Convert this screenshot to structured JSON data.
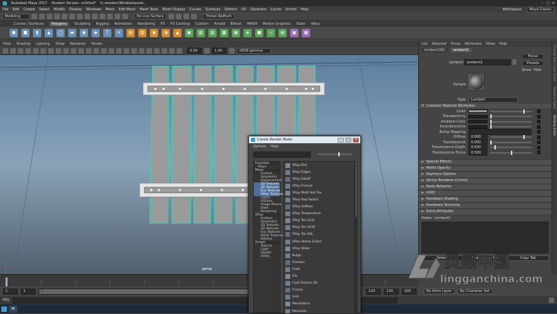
{
  "window": {
    "title_app": "Autodesk Maya 2017",
    "title_version": "Student Version: untitled*",
    "title_path": "\\\\\\ wooden\\Window\\wood..."
  },
  "menubar": {
    "items": [
      "File",
      "Edit",
      "Create",
      "Select",
      "Modify",
      "Display",
      "Windows",
      "Mesh",
      "Edit Mesh",
      "Mesh Tools",
      "Mesh Display",
      "Curves",
      "Surfaces",
      "Deform",
      "UV",
      "Generate",
      "Cache",
      "Arnold",
      "Help"
    ],
    "workspace_label": "Workspace:",
    "workspace_value": "Maya Classic"
  },
  "statusline": {
    "mode": "Modeling",
    "live_surface": "No Live Surface",
    "user": "Tristan Reifisch"
  },
  "shelf_tabs": [
    "Curves / Surfaces",
    "Polygons",
    "Sculpting",
    "Rigging",
    "Animation",
    "Rendering",
    "FX",
    "FX Caching",
    "Custom",
    "Arnold",
    "Bifrost",
    "MASH",
    "Motion Graphics",
    "XGen",
    "VRay"
  ],
  "viewport": {
    "menu": [
      "View",
      "Shading",
      "Lighting",
      "Show",
      "Renderer",
      "Panels"
    ],
    "field_a": "0.00",
    "field_b": "1.00",
    "color_space": "sRGB gamma",
    "camera_label": "persp"
  },
  "timeline": {
    "range_start": "1",
    "range_current": "1",
    "range_field": "1",
    "range_end_a": "120",
    "range_end_b": "120",
    "range_end_c": "200",
    "anim_layer": "No Anim Layer",
    "char_set": "No Character Set",
    "frame_right": "1"
  },
  "cmdline": {
    "label": "MEL"
  },
  "taskbar": {
    "item": "M"
  },
  "attribute_editor": {
    "menu": [
      "List",
      "Selected",
      "Focus",
      "Attributes",
      "Show",
      "Help"
    ],
    "tabs": [
      "lambert2SG",
      "lambert2"
    ],
    "node_label": "lambert:",
    "node_value": "lambert2",
    "focus_button": "Focus",
    "presets_button": "Presets",
    "show_button": "Show",
    "hide_button": "Hide",
    "sample_label": "Sample",
    "type_label": "Type",
    "type_value": "Lambert",
    "section_common": "Common Material Attributes",
    "attrs": [
      {
        "label": "Color",
        "value": ""
      },
      {
        "label": "Transparency",
        "value": ""
      },
      {
        "label": "Ambient Color",
        "value": ""
      },
      {
        "label": "Incandescence",
        "value": ""
      },
      {
        "label": "Bump Mapping",
        "value": ""
      },
      {
        "label": "Diffuse",
        "value": "0.800"
      },
      {
        "label": "Translucence",
        "value": "0.000"
      },
      {
        "label": "Translucence Depth",
        "value": "0.500"
      },
      {
        "label": "Translucence Focus",
        "value": "0.500"
      }
    ],
    "sections": [
      "Special Effects",
      "Matte Opacity",
      "Raytrace Options",
      "Vector Renderer Control",
      "Node Behavior",
      "UUID",
      "Hardware Shading",
      "Hardware Texturing",
      "Extra Attributes"
    ],
    "notes_label": "Notes:",
    "notes_value": "lambert2",
    "bottom_buttons": [
      "Select",
      "Load Attributes",
      "Copy Tab"
    ]
  },
  "right_strip": [
    "Channel Box / Layer Editor",
    "Modeling Toolkit",
    "Attribute Editor"
  ],
  "create_render_node": {
    "title": "Create Render Node",
    "menu": [
      "Options",
      "Help"
    ],
    "tree": [
      {
        "label": "Favorites",
        "kind": "head"
      },
      {
        "label": "Maya",
        "kind": "head2"
      },
      {
        "label": "Maya",
        "kind": "head"
      },
      {
        "label": "Surface",
        "kind": "item"
      },
      {
        "label": "Volumetric",
        "kind": "item"
      },
      {
        "label": "Displacement",
        "kind": "item"
      },
      {
        "label": "2D Textures",
        "kind": "hl"
      },
      {
        "label": "3D Textures",
        "kind": "hl"
      },
      {
        "label": "Env Textures",
        "kind": "hl"
      },
      {
        "label": "Other Textures",
        "kind": "hl"
      },
      {
        "label": "Lights",
        "kind": "item"
      },
      {
        "label": "Utilities",
        "kind": "item"
      },
      {
        "label": "Image Planes",
        "kind": "item"
      },
      {
        "label": "Glow",
        "kind": "item"
      },
      {
        "label": "Rendering",
        "kind": "item"
      },
      {
        "label": "VRay",
        "kind": "head"
      },
      {
        "label": "Surface",
        "kind": "item"
      },
      {
        "label": "Volumetric",
        "kind": "item"
      },
      {
        "label": "2D Textures",
        "kind": "item"
      },
      {
        "label": "3D Textures",
        "kind": "item"
      },
      {
        "label": "Env Textures",
        "kind": "item"
      },
      {
        "label": "Other Textures",
        "kind": "item"
      },
      {
        "label": "Utilities",
        "kind": "item"
      },
      {
        "label": "Arnold",
        "kind": "head"
      },
      {
        "label": "Texture",
        "kind": "item"
      },
      {
        "label": "Light",
        "kind": "item"
      },
      {
        "label": "Shader",
        "kind": "item"
      },
      {
        "label": "Utility",
        "kind": "item"
      }
    ],
    "nodes": [
      "VRay Dirt",
      "VRay Edges",
      "VRay Falloff",
      "VRay Fresnel",
      "VRay Multi Sub Tex",
      "VRay Rap Switch",
      "VRay Softbox",
      "VRay Temperature",
      "VRay Tex GLSL",
      "VRay Tex OCIO",
      "VRay Tex OSL",
      "VRay Vertex Colors",
      "VRay Water",
      "Bulge",
      "Checker",
      "Cloth",
      "File",
      "Fluid Texture 2D",
      "Fractal",
      "Grid",
      "Mandelbrot",
      "Mountain"
    ]
  },
  "watermark": {
    "text_cn": "灵感中国",
    "text_en": "lingganchina.com"
  }
}
